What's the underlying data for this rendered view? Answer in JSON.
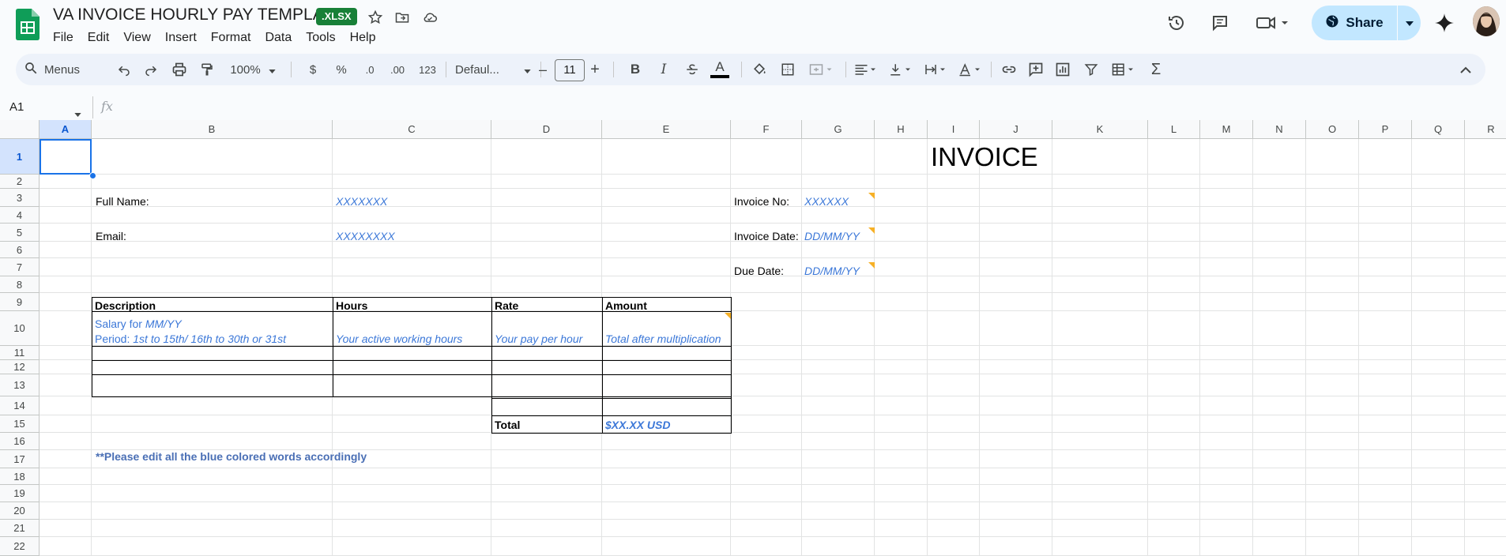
{
  "app": {
    "title": "VA INVOICE HOURLY PAY TEMPLATE",
    "badge": ".XLSX",
    "menu": [
      "File",
      "Edit",
      "View",
      "Insert",
      "Format",
      "Data",
      "Tools",
      "Help"
    ],
    "share_label": "Share"
  },
  "toolbar": {
    "search_label": "Menus",
    "zoom": "100%",
    "currency": "$",
    "percent": "%",
    "dec_decrease": ".0",
    "dec_increase": ".00",
    "number_format": "123",
    "font": "Defaul...",
    "font_size": "11",
    "bold": "B",
    "italic": "I",
    "text_color": "A"
  },
  "formula_bar": {
    "name_box": "A1",
    "fx": "fx",
    "value": ""
  },
  "grid": {
    "columns": [
      "A",
      "B",
      "C",
      "D",
      "E",
      "F",
      "G",
      "H",
      "I",
      "J",
      "K",
      "L",
      "M",
      "N",
      "O",
      "P",
      "Q",
      "R"
    ],
    "rows": [
      "1",
      "2",
      "3",
      "4",
      "5",
      "6",
      "7",
      "8",
      "9",
      "10",
      "11",
      "12",
      "13",
      "14",
      "15",
      "16",
      "17",
      "18",
      "19",
      "20",
      "21",
      "22"
    ],
    "selected_cell": "A1"
  },
  "sheet": {
    "invoice_title": "INVOICE",
    "full_name_label": "Full Name:",
    "full_name_value": "XXXXXXX",
    "email_label": "Email:",
    "email_value": "XXXXXXXX",
    "invoice_no_label": "Invoice No:",
    "invoice_no_value": "XXXXXX",
    "invoice_date_label": "Invoice Date:",
    "invoice_date_value": "DD/MM/YY",
    "due_date_label": "Due Date:",
    "due_date_value": "DD/MM/YY",
    "table_headers": [
      "Description",
      "Hours",
      "Rate",
      "Amount"
    ],
    "desc_line1_prefix": "Salary for ",
    "desc_line1_value": "MM/YY",
    "desc_line2_prefix": "Period: ",
    "desc_line2_value": "1st to 15th/ 16th to 30th or 31st",
    "hours_value": "Your active working hours",
    "rate_value": "Your pay per hour",
    "amount_value": "Total after multiplication",
    "total_label": "Total",
    "total_value": "$XX.XX USD",
    "note": "**Please edit all the blue colored words accordingly"
  }
}
